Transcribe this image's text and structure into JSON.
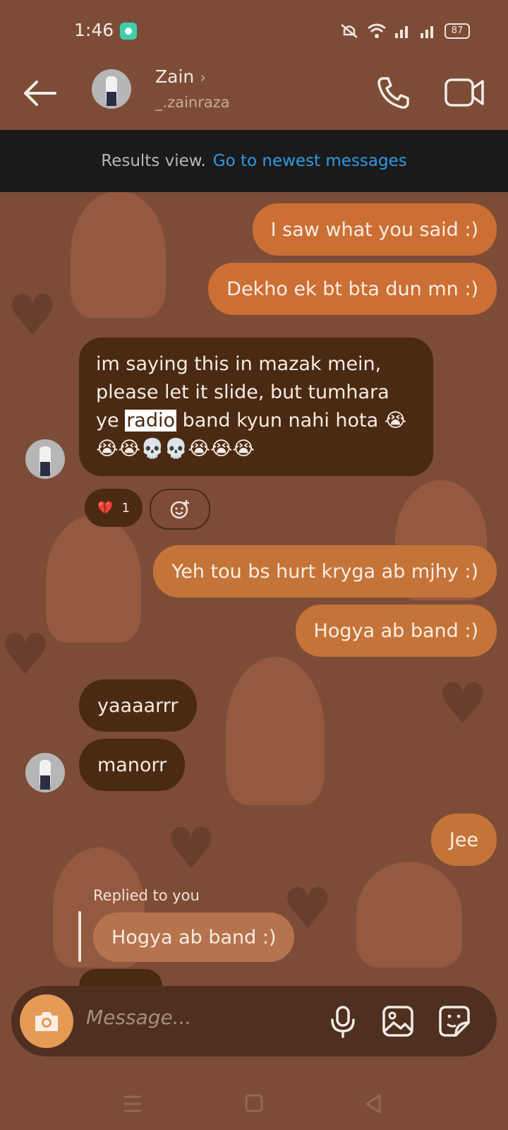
{
  "status_bar": {
    "time": "1:46",
    "battery": "87"
  },
  "header": {
    "name": "Zain",
    "username": "_.zainraza"
  },
  "banner": {
    "prefix": "Results view.",
    "link": "Go to newest messages"
  },
  "messages": {
    "m1": "I saw what you said :)",
    "m2": "Dekho ek bt bta dun mn :)",
    "m3_a": "im saying this in mazak mein, please let it slide, but tumhara ye ",
    "m3_highlight": "radio",
    "m3_b": " band kyun nahi hota 😭😭😭💀💀😭😭😭",
    "m4": "Yeh tou bs hurt kryga ab mjhy :)",
    "m5": "Hogya ab band :)",
    "m6": "yaaaarrr",
    "m7": "manorr",
    "m8": "Jee",
    "replied_label": "Replied to you",
    "reply_quote": "Hogya ab band :)"
  },
  "reaction": {
    "emoji": "💔",
    "count": "1"
  },
  "composer": {
    "placeholder": "Message..."
  },
  "colors": {
    "background": "#7d4c37",
    "outgoing": "#cc6f35",
    "incoming": "#4a2a12",
    "link": "#2f9be7"
  },
  "icons": [
    "back-arrow-icon",
    "chevron-right-icon",
    "phone-icon",
    "video-camera-icon",
    "camera-icon",
    "microphone-icon",
    "gallery-icon",
    "sticker-icon",
    "react-add-icon"
  ]
}
